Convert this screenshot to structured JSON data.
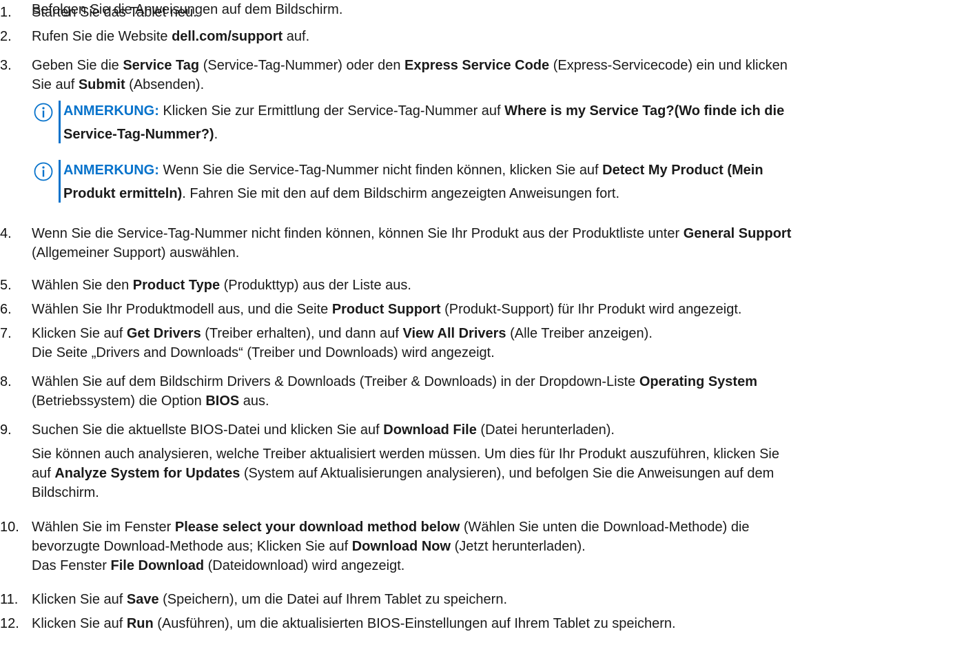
{
  "steps": [
    {
      "num": "1.",
      "lines": [
        [
          {
            "t": "Starten Sie das Tablet neu."
          }
        ]
      ]
    },
    {
      "num": "2.",
      "lines": [
        [
          {
            "t": "Rufen Sie die Website "
          },
          {
            "t": "dell.com/support",
            "b": true
          },
          {
            "t": " auf."
          }
        ]
      ]
    },
    {
      "num": "3.",
      "lines": [
        [
          {
            "t": "Geben Sie die "
          },
          {
            "t": "Service Tag",
            "b": true
          },
          {
            "t": " (Service-Tag-Nummer) oder den "
          },
          {
            "t": "Express Service Code",
            "b": true
          },
          {
            "t": " (Express-Servicecode) ein und klicken"
          }
        ],
        [
          {
            "t": "Sie auf "
          },
          {
            "t": "Submit",
            "b": true
          },
          {
            "t": " (Absenden)."
          }
        ]
      ]
    },
    {
      "num": "4.",
      "lines": [
        [
          {
            "t": "Wenn Sie die Service-Tag-Nummer nicht finden können, können Sie Ihr Produkt aus der Produktliste unter "
          },
          {
            "t": "General Support",
            "b": true
          }
        ],
        [
          {
            "t": "(Allgemeiner Support) auswählen."
          }
        ]
      ]
    },
    {
      "num": "5.",
      "lines": [
        [
          {
            "t": "Wählen Sie den "
          },
          {
            "t": "Product Type",
            "b": true
          },
          {
            "t": " (Produkttyp) aus der Liste aus."
          }
        ]
      ]
    },
    {
      "num": "6.",
      "lines": [
        [
          {
            "t": "Wählen Sie Ihr Produktmodell aus, und die Seite "
          },
          {
            "t": "Product Support",
            "b": true
          },
          {
            "t": " (Produkt-Support) für Ihr Produkt wird angezeigt."
          }
        ]
      ]
    },
    {
      "num": "7.",
      "lines": [
        [
          {
            "t": "Klicken Sie auf "
          },
          {
            "t": "Get Drivers",
            "b": true
          },
          {
            "t": " (Treiber erhalten), und dann auf "
          },
          {
            "t": "View All Drivers",
            "b": true
          },
          {
            "t": " (Alle Treiber anzeigen)."
          }
        ],
        [
          {
            "t": "Die Seite „Drivers and Downloads“ (Treiber und Downloads) wird angezeigt."
          }
        ]
      ]
    },
    {
      "num": "8.",
      "lines": [
        [
          {
            "t": "Wählen Sie auf dem Bildschirm Drivers & Downloads (Treiber & Downloads) in der Dropdown-Liste "
          },
          {
            "t": "Operating System",
            "b": true
          }
        ],
        [
          {
            "t": "(Betriebssystem) die Option "
          },
          {
            "t": "BIOS",
            "b": true
          },
          {
            "t": " aus."
          }
        ]
      ]
    },
    {
      "num": "9.",
      "lines": [
        [
          {
            "t": "Suchen Sie die aktuellste BIOS-Datei und klicken Sie auf "
          },
          {
            "t": "Download File",
            "b": true
          },
          {
            "t": " (Datei herunterladen)."
          }
        ]
      ]
    },
    {
      "num": "",
      "lines": [
        [
          {
            "t": "Sie können auch analysieren, welche Treiber aktualisiert werden müssen. Um dies für Ihr Produkt auszuführen, klicken Sie"
          }
        ],
        [
          {
            "t": "auf "
          },
          {
            "t": "Analyze System for Updates",
            "b": true
          },
          {
            "t": " (System auf Aktualisierungen analysieren), und befolgen Sie die Anweisungen auf dem"
          }
        ],
        [
          {
            "t": "Bildschirm."
          }
        ]
      ]
    },
    {
      "num": "10.",
      "lines": [
        [
          {
            "t": "Wählen Sie im Fenster "
          },
          {
            "t": "Please select your download method below",
            "b": true
          },
          {
            "t": " (Wählen Sie unten die Download-Methode) die"
          }
        ],
        [
          {
            "t": "bevorzugte Download-Methode aus; Klicken Sie auf "
          },
          {
            "t": "Download Now",
            "b": true
          },
          {
            "t": " (Jetzt herunterladen)."
          }
        ],
        [
          {
            "t": "Das Fenster "
          },
          {
            "t": "File Download",
            "b": true
          },
          {
            "t": " (Dateidownload) wird angezeigt."
          }
        ]
      ]
    },
    {
      "num": "11.",
      "lines": [
        [
          {
            "t": "Klicken Sie auf "
          },
          {
            "t": "Save",
            "b": true
          },
          {
            "t": " (Speichern), um die Datei auf Ihrem Tablet zu speichern."
          }
        ]
      ]
    },
    {
      "num": "12.",
      "lines": [
        [
          {
            "t": "Klicken Sie auf "
          },
          {
            "t": "Run",
            "b": true
          },
          {
            "t": " (Ausführen), um die aktualisierten BIOS-Einstellungen auf Ihrem Tablet zu speichern."
          }
        ]
      ]
    },
    {
      "num": "",
      "lines": [
        [
          {
            "t": "Befolgen Sie die Anweisungen auf dem Bildschirm."
          }
        ]
      ]
    }
  ],
  "notes": [
    {
      "label": "ANMERKUNG:",
      "lines": [
        [
          {
            "t": " Klicken Sie zur Ermittlung der Service-Tag-Nummer auf "
          },
          {
            "t": "Where is my Service Tag?(Wo finde ich die",
            "b": true
          }
        ],
        [
          {
            "t": "Service-Tag-Nummer?)",
            "b": true
          },
          {
            "t": "."
          }
        ]
      ]
    },
    {
      "label": "ANMERKUNG:",
      "lines": [
        [
          {
            "t": " Wenn Sie die Service-Tag-Nummer nicht finden können, klicken Sie auf "
          },
          {
            "t": "Detect My Product (Mein",
            "b": true
          }
        ],
        [
          {
            "t": "Produkt ermitteln)",
            "b": true
          },
          {
            "t": ". Fahren Sie mit den auf dem Bildschirm angezeigten Anweisungen fort."
          }
        ]
      ]
    }
  ],
  "colors": {
    "accent": "#0672cb",
    "text": "#1a1a1a"
  },
  "icons": {
    "note": "info-icon"
  }
}
